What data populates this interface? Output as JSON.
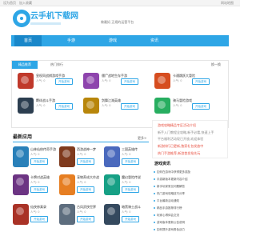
{
  "topbar": {
    "links": [
      "设为首页",
      "加入收藏"
    ],
    "right": "网站地图"
  },
  "logo": {
    "text": "云手机下载网"
  },
  "header": {
    "slogan": "做最好,正规的运营平台"
  },
  "nav": [
    "首页",
    "手游",
    "游戏",
    "资讯"
  ],
  "hot": {
    "tab_active": "精品推荐",
    "tab_other": "热门排行",
    "more": "换一换",
    "button_label": "开始游戏",
    "games": [
      {
        "name": "皇权同战棋游戏手游",
        "meta": "人气: 0",
        "color": "#c0392b"
      },
      {
        "name": "僵尸战地生存手游",
        "meta": "人气: 0",
        "color": "#8e44ad"
      },
      {
        "name": "卡通跳跃大冒险",
        "meta": "人气: 0",
        "color": "#d64d1f"
      },
      {
        "name": "羁绊战斗手游",
        "meta": "人气: 0",
        "color": "#2c3e50"
      },
      {
        "name": "剑舞江湖英雄",
        "meta": "人气: 0",
        "color": "#b8860b"
      },
      {
        "name": "骑马冒险游戏",
        "meta": "人气: 0",
        "color": "#27ae60"
      }
    ]
  },
  "latest": {
    "title": "最新应用",
    "more": "更多>",
    "button_label": "开始游戏",
    "games": [
      {
        "name": "山林仙侠传奇手游",
        "meta": "人气: 0",
        "color": "#2980b9"
      },
      {
        "name": "西游战神一梦",
        "meta": "人气: 0",
        "color": "#7f3a1d"
      },
      {
        "name": "三国英雄传",
        "meta": "人气: 0",
        "color": "#4a69bd"
      },
      {
        "name": "卡牌对战英雄",
        "meta": "人气: 0",
        "color": "#6c3483"
      },
      {
        "name": "宠物养成大作战",
        "meta": "人气: 0",
        "color": "#e67e22"
      },
      {
        "name": "魔幻冒险传说",
        "meta": "人气: 0",
        "color": "#16a085"
      },
      {
        "name": "仙侠修真录",
        "meta": "人气: 0",
        "color": "#a93226"
      },
      {
        "name": "古风武侠世界",
        "meta": "人气: 0",
        "color": "#5d6d7e"
      },
      {
        "name": "暗黑骑士战斗",
        "meta": "人气: 0",
        "color": "#34495e"
      }
    ]
  },
  "banner": {
    "lines": [
      {
        "text": "游戏攻略精品专区活动介绍",
        "color": "#e74c3c"
      },
      {
        "text": "新手入门教程全攻略,新手必看,快速上手",
        "color": "#888"
      },
      {
        "text": "平台福利活动现已开放,欢迎体验",
        "color": "#888"
      },
      {
        "text": "新游排行已更新,独家礼包发放中",
        "color": "#e74c3c"
      },
      {
        "text": "热门手游推荐,新游首发抢先玩",
        "color": "#e74c3c"
      }
    ]
  },
  "news": {
    "title": "游戏资讯",
    "items": [
      "如何在游戏中获得更多奖励",
      "手游新版本更新内容介绍",
      "新手玩家常见问题解答",
      "热门游戏攻略技巧分享",
      "平台最新活动通知",
      "精品手游推荐排行榜",
      "玩家心得体会交流",
      "游戏版本更新公告说明",
      "如何提升游戏角色战力"
    ]
  }
}
